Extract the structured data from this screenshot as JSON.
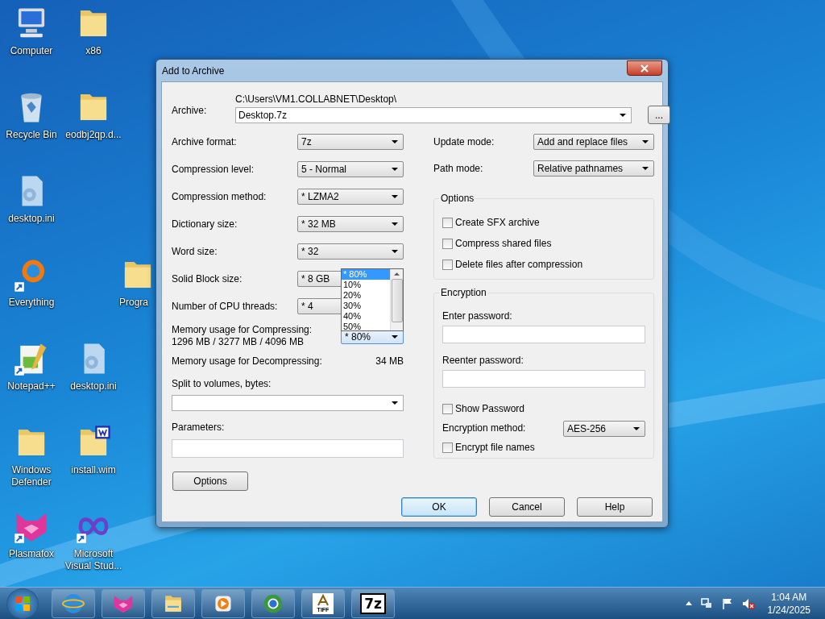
{
  "desktop_icons": [
    {
      "label": "Computer",
      "kind": "computer",
      "shortcut": false
    },
    {
      "label": "x86",
      "kind": "folder",
      "shortcut": false
    },
    {
      "label": "Recycle Bin",
      "kind": "recycle",
      "shortcut": false
    },
    {
      "label": "eodbj2qp.d...",
      "kind": "folder",
      "shortcut": false
    },
    {
      "label": "desktop.ini",
      "kind": "config",
      "shortcut": false
    },
    {
      "label": "Everything",
      "kind": "ring",
      "shortcut": true
    },
    {
      "label": "Progra",
      "kind": "folder",
      "shortcut": false
    },
    {
      "label": "Notepad++",
      "kind": "notepad",
      "shortcut": true
    },
    {
      "label": "desktop.ini",
      "kind": "config",
      "shortcut": false
    },
    {
      "label": "Windows Defender",
      "kind": "folder",
      "shortcut": false
    },
    {
      "label": "install.wim",
      "kind": "wim",
      "shortcut": false
    },
    {
      "label": "Plasmafox",
      "kind": "fox",
      "shortcut": true
    },
    {
      "label": "Microsoft Visual Stud...",
      "kind": "infinity",
      "shortcut": true
    }
  ],
  "dialog": {
    "title": "Add to Archive",
    "archive": {
      "label": "Archive:",
      "path": "C:\\Users\\VM1.COLLABNET\\Desktop\\",
      "value": "Desktop.7z",
      "browse_button": "..."
    },
    "left_fields": [
      {
        "label": "Archive format:",
        "value": "7z"
      },
      {
        "label": "Compression level:",
        "value": "5 - Normal"
      },
      {
        "label": "Compression method:",
        "value": "* LZMA2"
      },
      {
        "label": "Dictionary size:",
        "value": "* 32 MB"
      },
      {
        "label": "Word size:",
        "value": "* 32"
      },
      {
        "label": "Solid Block size:",
        "value": "* 8 GB"
      },
      {
        "label": "Number of CPU threads:",
        "value": "* 4"
      }
    ],
    "memory_compress": {
      "label": "Memory usage for Compressing:",
      "value": "1296 MB / 3277 MB / 4096 MB",
      "combo": "* 80%"
    },
    "memory_decompress": {
      "label": "Memory usage for Decompressing:",
      "value": "34 MB"
    },
    "split": {
      "label": "Split to volumes, bytes:"
    },
    "parameters": {
      "label": "Parameters:"
    },
    "options_button": "Options",
    "right_fields": [
      {
        "label": "Update mode:",
        "value": "Add and replace files"
      },
      {
        "label": "Path mode:",
        "value": "Relative pathnames"
      }
    ],
    "options_group": {
      "title": "Options",
      "checkboxes": [
        {
          "label": "Create SFX archive",
          "checked": false
        },
        {
          "label": "Compress shared files",
          "checked": false
        },
        {
          "label": "Delete files after compression",
          "checked": false
        }
      ]
    },
    "encryption": {
      "title": "Encryption",
      "password_label": "Enter password:",
      "reenter_label": "Reenter password:",
      "show_password": {
        "label": "Show Password",
        "checked": false
      },
      "method": {
        "label": "Encryption method:",
        "value": "AES-256"
      },
      "encrypt_names": {
        "label": "Encrypt file names",
        "checked": false
      }
    },
    "buttons": [
      {
        "label": "OK",
        "default": true
      },
      {
        "label": "Cancel",
        "default": false
      },
      {
        "label": "Help",
        "default": false
      }
    ],
    "dropdown_list": [
      {
        "label": "* 80%",
        "selected": true
      },
      {
        "label": "10%",
        "selected": false
      },
      {
        "label": "20%",
        "selected": false
      },
      {
        "label": "30%",
        "selected": false
      },
      {
        "label": "40%",
        "selected": false
      },
      {
        "label": "50%",
        "selected": false
      }
    ]
  },
  "taskbar": {
    "items": [
      {
        "kind": "ie"
      },
      {
        "kind": "fox"
      },
      {
        "kind": "explorer"
      },
      {
        "kind": "media"
      },
      {
        "kind": "globe"
      },
      {
        "kind": "tiff",
        "label": "TIFF"
      },
      {
        "kind": "sevenzip",
        "label": "7z"
      }
    ],
    "tray": {
      "time": "1:04 AM",
      "date": "1/24/2025"
    }
  }
}
